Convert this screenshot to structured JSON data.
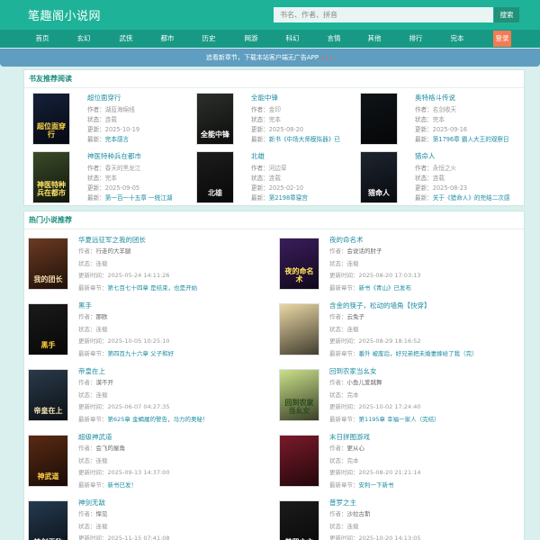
{
  "header": {
    "logo": "笔趣阁小说网",
    "search_placeholder": "书名、作者、拼音",
    "search_button": "搜索"
  },
  "nav": {
    "items": [
      "首页",
      "玄幻",
      "武侠",
      "都市",
      "历史",
      "网游",
      "科幻",
      "言情",
      "其他",
      "排行",
      "完本"
    ],
    "login": "登录"
  },
  "notice": {
    "text": "追看新章节，下载本站客户端无广告APP",
    "arrows": "↓↓↓"
  },
  "recommend": {
    "title": "书友推荐阅读",
    "labels": {
      "author": "作者：",
      "status": "状态：",
      "update": "更新：",
      "latest": "最新："
    },
    "items": [
      {
        "title": "超位面穿行",
        "author": "湖蓝海绵线",
        "status": "连载",
        "update": "2025-10-19",
        "latest": "完本感言",
        "cover_text": "超位面穿行",
        "cover_bg": "#16203a",
        "cover_fg": "#ffd84a"
      },
      {
        "title": "全能中锋",
        "author": "金印",
        "status": "完本",
        "update": "2025-08-20",
        "latest": "新书《中场大师模拟器》已",
        "cover_text": "全能中锋",
        "cover_bg": "#2b2f2a",
        "cover_fg": "#ffffff"
      },
      {
        "title": "奥特格斗传说",
        "author": "名剑收天",
        "status": "完本",
        "update": "2025-09-16",
        "latest": "第1796章 霸人大王的观察日",
        "cover_text": "",
        "cover_bg": "#101418",
        "cover_fg": "#ffffff"
      },
      {
        "title": "神医特种兵在都市",
        "author": "春天的黑龙江",
        "status": "完本",
        "update": "2025-09-05",
        "latest": "第一百一十五章 一统江湖",
        "cover_text": "神医特种兵在都市",
        "cover_bg": "#3a4a2a",
        "cover_fg": "#ffe36a"
      },
      {
        "title": "北雄",
        "author": "河边草",
        "status": "连载",
        "update": "2025-02-10",
        "latest": "第2198章寝宫",
        "cover_text": "北雄",
        "cover_bg": "#1c1c1c",
        "cover_fg": "#e8e8e8"
      },
      {
        "title": "猎命人",
        "author": "永恒之火",
        "status": "连载",
        "update": "2025-08-23",
        "latest": "关于《猎命人》的完结二次感",
        "cover_text": "猎命人",
        "cover_bg": "#1e2530",
        "cover_fg": "#ffffff"
      }
    ]
  },
  "hot": {
    "title": "热门小说推荐",
    "labels": {
      "author": "作者：",
      "status": "状态：",
      "update": "更新时间：",
      "latest": "最新章节："
    },
    "items": [
      {
        "title": "华夏远征军之我的团长",
        "author": "行走的大羊腿",
        "status": "连载",
        "update": "2025-05-24 14:11:26",
        "latest": "第七百七十四章 是结束，也是开始",
        "cover_text": "我的团长",
        "cover_bg": "#6b3a22",
        "cover_fg": "#f3d9a8"
      },
      {
        "title": "夜的命名术",
        "author": "会说话的肘子",
        "status": "连载",
        "update": "2025-08-20 17:03:13",
        "latest": "新书《青山》已发布",
        "cover_text": "夜的命名术",
        "cover_bg": "#3a1d5c",
        "cover_fg": "#ffe25a"
      },
      {
        "title": "黑手",
        "author": "那欧",
        "status": "连载",
        "update": "2025-10-05 10:25:10",
        "latest": "第四百九十六章 父子和好",
        "cover_text": "黑手",
        "cover_bg": "#1a1a1a",
        "cover_fg": "#ffd23a"
      },
      {
        "title": "含金的筷子，松动的墙角【快穿】",
        "author": "云兔子",
        "status": "连载",
        "update": "2025-08-29 18:16:52",
        "latest": "番外 被废后，好兄弟把未婚妻嫁给了我（完）",
        "cover_text": "",
        "cover_bg": "#e9d7a4",
        "cover_fg": "#8a5a2a"
      },
      {
        "title": "帝皇在上",
        "author": "漠不开",
        "status": "连载",
        "update": "2025-06-07 04:27:35",
        "latest": "第625章 金蝎履的警告，马力的奥秘！",
        "cover_text": "帝皇在上",
        "cover_bg": "#2a3a4a",
        "cover_fg": "#f2e2b0"
      },
      {
        "title": "回到农家当幺女",
        "author": "小鱼儿爱跳舞",
        "status": "完本",
        "update": "2025-10-02 17:24:40",
        "latest": "第1195章 幸福一家人（完结）",
        "cover_text": "回到农家当幺女",
        "cover_bg": "#c9e08a",
        "cover_fg": "#2a4a1a"
      },
      {
        "title": "超级神武道",
        "author": "会飞的屋角",
        "status": "连载",
        "update": "2025-09-13 14:37:00",
        "latest": "新书已发！",
        "cover_text": "神武道",
        "cover_bg": "#5a2a14",
        "cover_fg": "#ffd24a"
      },
      {
        "title": "末日拼图游戏",
        "author": "更从心",
        "status": "完本",
        "update": "2025-08-20 21:21:14",
        "latest": "安利一下新书",
        "cover_text": "",
        "cover_bg": "#7a1a2a",
        "cover_fg": "#ffffff"
      },
      {
        "title": "神剑无敌",
        "author": "悍见",
        "status": "连载",
        "update": "2025-11-15 07:41:08",
        "latest": "",
        "cover_text": "神剑无敌",
        "cover_bg": "#243a50",
        "cover_fg": "#f2f2f2"
      },
      {
        "title": "普罗之主",
        "author": "沙拉古斯",
        "status": "连载",
        "update": "2025-10-20 14:13:05",
        "latest": "",
        "cover_text": "普罗之主",
        "cover_bg": "#1b1b1b",
        "cover_fg": "#ffffff"
      }
    ]
  }
}
